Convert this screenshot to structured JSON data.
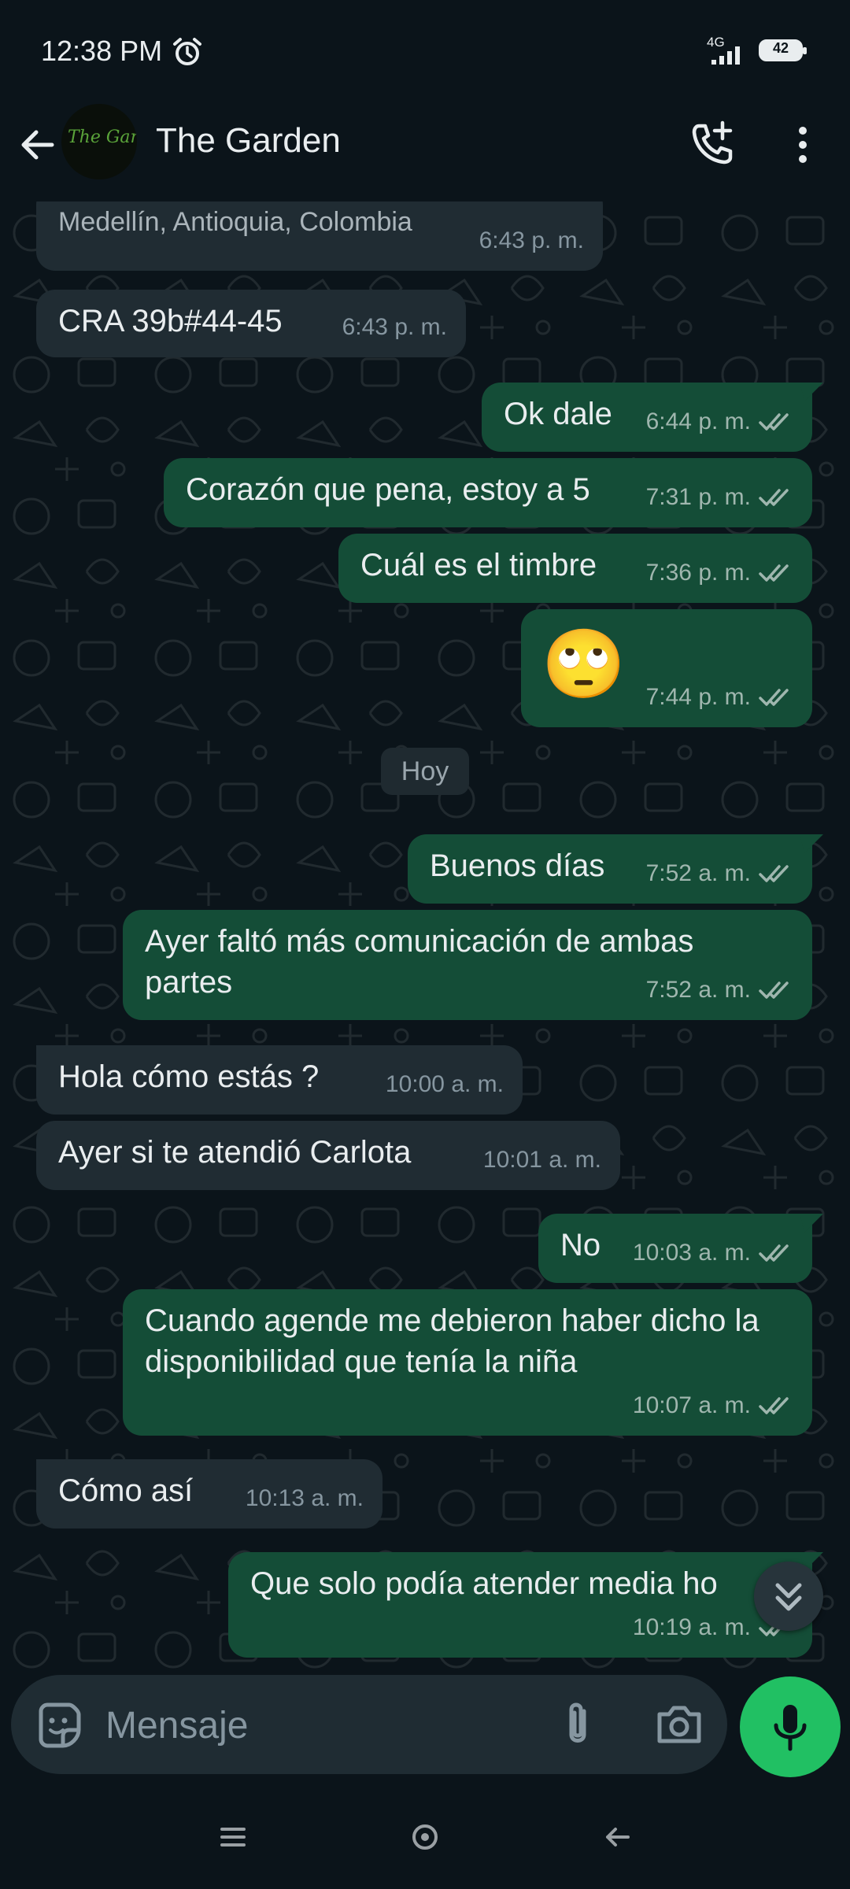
{
  "status_bar": {
    "time": "12:38 PM",
    "network": "4G",
    "battery": "42"
  },
  "header": {
    "contact_name": "The Garden",
    "avatar_text": "The Garden"
  },
  "day_divider": "Hoy",
  "composer": {
    "placeholder": "Mensaje"
  },
  "messages": [
    {
      "dir": "in",
      "text": "Medellín, Antioquia, Colombia",
      "time": "6:43 p. m."
    },
    {
      "dir": "in",
      "text": "CRA 39b#44-45",
      "time": "6:43 p. m."
    },
    {
      "dir": "out",
      "text": "Ok dale",
      "time": "6:44 p. m."
    },
    {
      "dir": "out",
      "text": "Corazón que pena, estoy a 5",
      "time": "7:31 p. m."
    },
    {
      "dir": "out",
      "text": "Cuál es el timbre",
      "time": "7:36 p. m."
    },
    {
      "dir": "out",
      "text": "🙄",
      "time": "7:44 p. m."
    },
    {
      "dir": "out",
      "text": "Buenos días",
      "time": "7:52 a. m."
    },
    {
      "dir": "out",
      "text": "Ayer faltó más comunicación de ambas partes",
      "time": "7:52 a. m."
    },
    {
      "dir": "in",
      "text": "Hola cómo estás ?",
      "time": "10:00 a. m."
    },
    {
      "dir": "in",
      "text": "Ayer si te atendió Carlota",
      "time": "10:01 a. m."
    },
    {
      "dir": "out",
      "text": "No",
      "time": "10:03 a. m."
    },
    {
      "dir": "out",
      "text": "Cuando agende me debieron haber dicho la disponibilidad que tenía la niña",
      "time": "10:07 a. m."
    },
    {
      "dir": "in",
      "text": "Cómo así",
      "time": "10:13 a. m."
    },
    {
      "dir": "out",
      "text": "Que solo podía atender media ho",
      "time": "10:19 a. m."
    }
  ],
  "colors": {
    "background": "#0b141a",
    "incoming": "#202c33",
    "outgoing": "#144d37",
    "accent": "#21c063",
    "read_ticks": "#9fb6ae"
  },
  "icons": [
    "back-arrow-icon",
    "add-call-icon",
    "more-vertical-icon",
    "sticker-icon",
    "attach-icon",
    "camera-icon",
    "mic-icon",
    "scroll-down-icon"
  ]
}
